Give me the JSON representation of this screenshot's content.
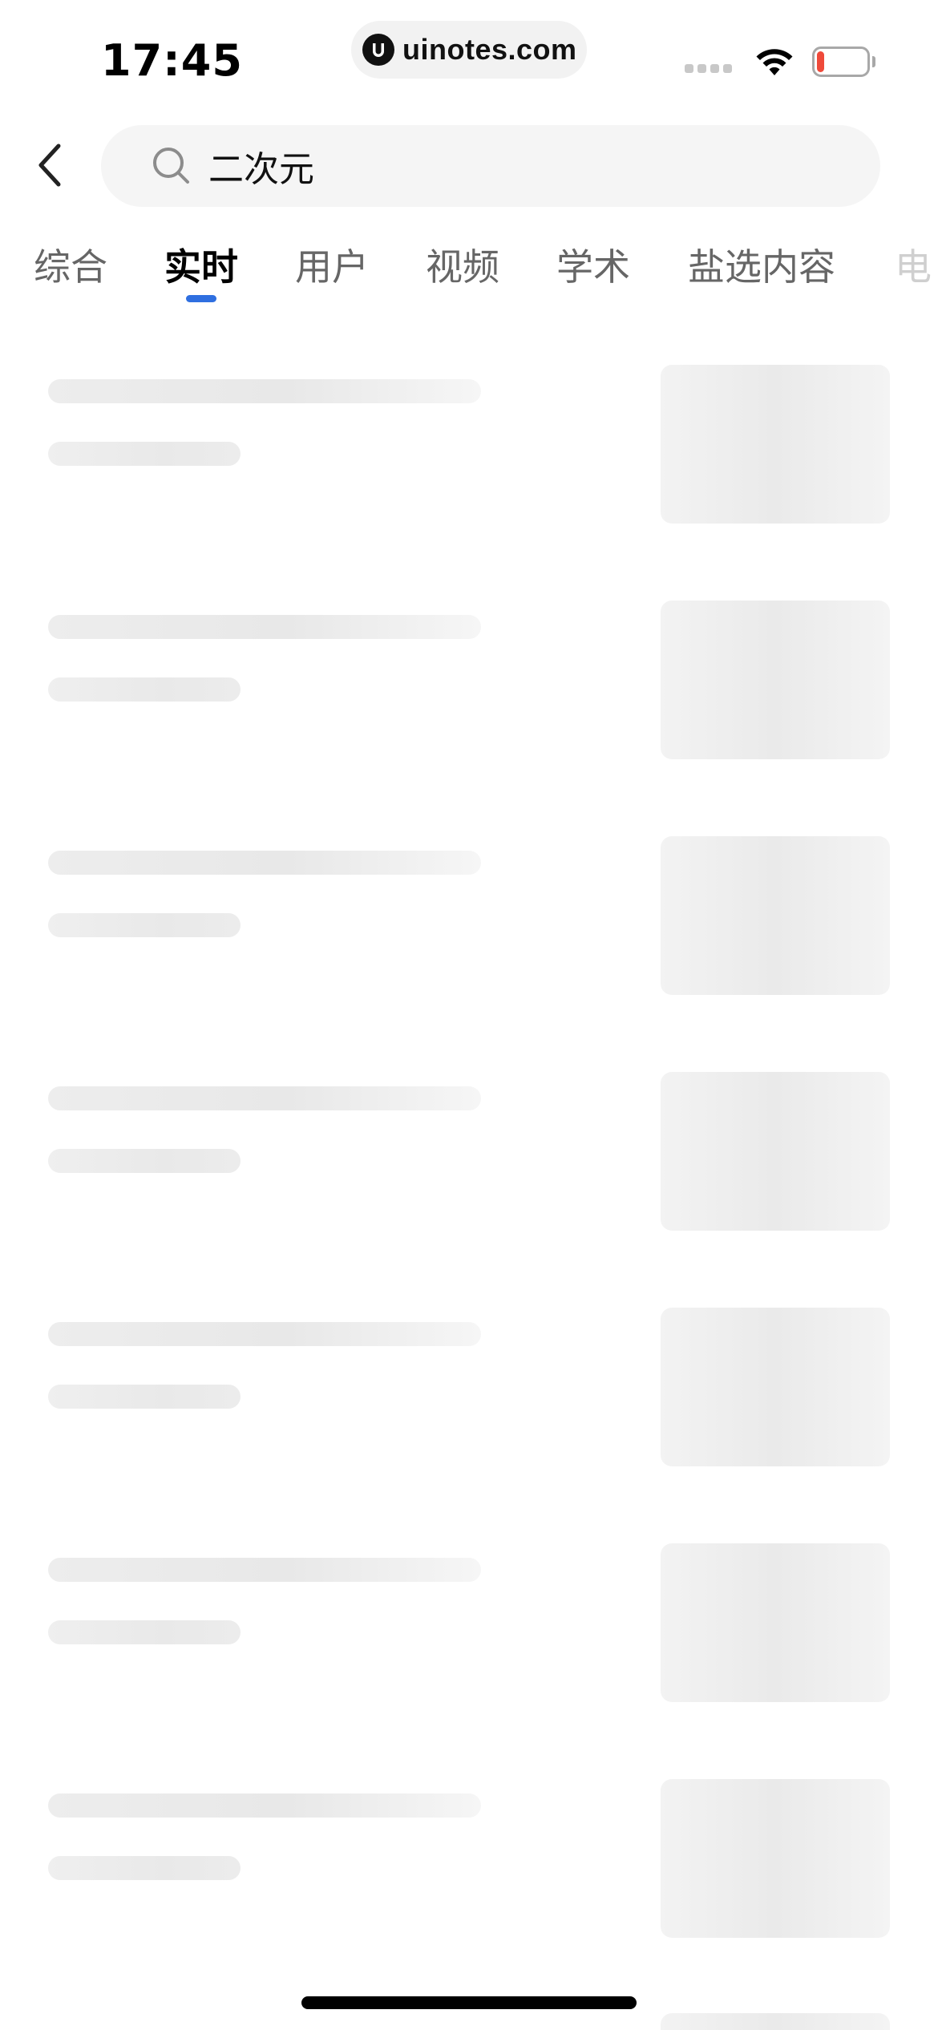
{
  "status_bar": {
    "time": "17:45",
    "url": "uinotes.com",
    "battery_level": 0.15,
    "battery_color": "#ef4a3a"
  },
  "search": {
    "back_icon": "chevron-left-icon",
    "search_icon": "search-icon",
    "query": "二次元"
  },
  "tabs": {
    "items": [
      {
        "label": "综合"
      },
      {
        "label": "实时"
      },
      {
        "label": "用户"
      },
      {
        "label": "视频"
      },
      {
        "label": "学术"
      },
      {
        "label": "盐选内容"
      },
      {
        "label": "电"
      }
    ],
    "active_index": 1,
    "active_color": "#2f6fe0"
  },
  "content": {
    "state": "loading",
    "skeleton_count": 8
  }
}
